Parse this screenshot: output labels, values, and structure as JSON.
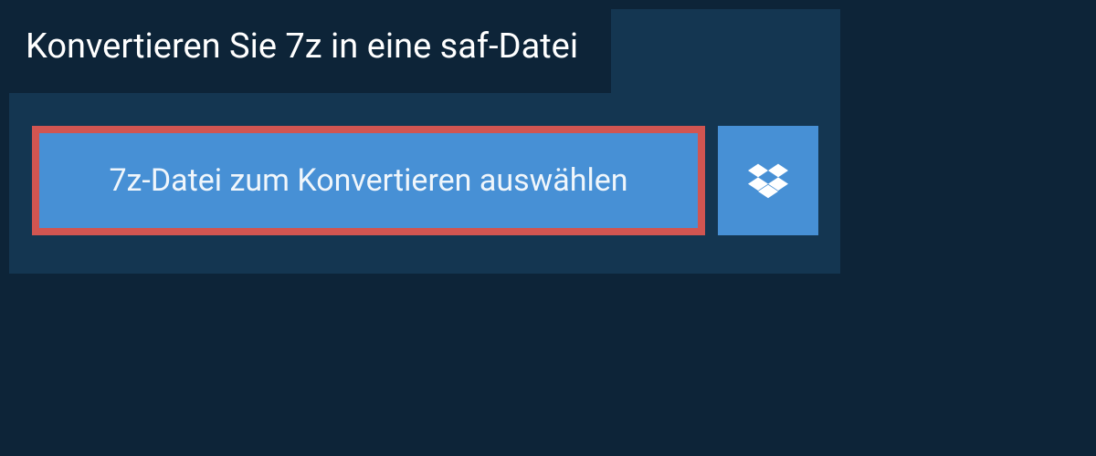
{
  "title": "Konvertieren Sie 7z in eine saf-Datei",
  "select_button_label": "7z-Datei zum Konvertieren auswählen",
  "colors": {
    "bg": "#0d2438",
    "panel": "#143651",
    "button": "#4790d5",
    "highlight_border": "#d15551"
  }
}
